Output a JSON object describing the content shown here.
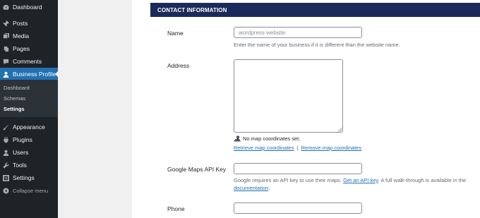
{
  "sidebar": {
    "items": [
      {
        "label": "Dashboard",
        "icon": "dashboard-icon"
      },
      {
        "label": "Posts",
        "icon": "pin-icon"
      },
      {
        "label": "Media",
        "icon": "media-icon"
      },
      {
        "label": "Pages",
        "icon": "pages-icon"
      },
      {
        "label": "Comments",
        "icon": "comment-icon"
      },
      {
        "label": "Business Profile",
        "icon": "user-icon",
        "active": true
      },
      {
        "label": "Appearance",
        "icon": "brush-icon"
      },
      {
        "label": "Plugins",
        "icon": "plugin-icon"
      },
      {
        "label": "Users",
        "icon": "users-icon"
      },
      {
        "label": "Tools",
        "icon": "wrench-icon"
      },
      {
        "label": "Settings",
        "icon": "settings-icon"
      }
    ],
    "submenu": [
      {
        "label": "Dashboard"
      },
      {
        "label": "Schemas"
      },
      {
        "label": "Settings",
        "current": true
      }
    ],
    "collapse_label": "Collapse menu",
    "accent_color": "#2271b1"
  },
  "section": {
    "title": "CONTACT INFORMATION",
    "header_color": "#1b2b59"
  },
  "form": {
    "name": {
      "label": "Name",
      "placeholder": "wordpress website",
      "description": "Enter the name of your business if it is different than the website name."
    },
    "address": {
      "label": "Address",
      "map_status": "No map coordinates set.",
      "retrieve_link": "Retrieve map coordinates",
      "separator": "|",
      "remove_link": "Remove map coordinates"
    },
    "google_maps": {
      "label": "Google Maps API Key",
      "desc_prefix": "Google requires an API key to use their maps. ",
      "get_key_link": "Get an API key",
      "desc_middle": ". A full walk-through is available in the",
      "doc_link": "documentation",
      "desc_suffix": "."
    },
    "phone": {
      "label": "Phone"
    }
  }
}
